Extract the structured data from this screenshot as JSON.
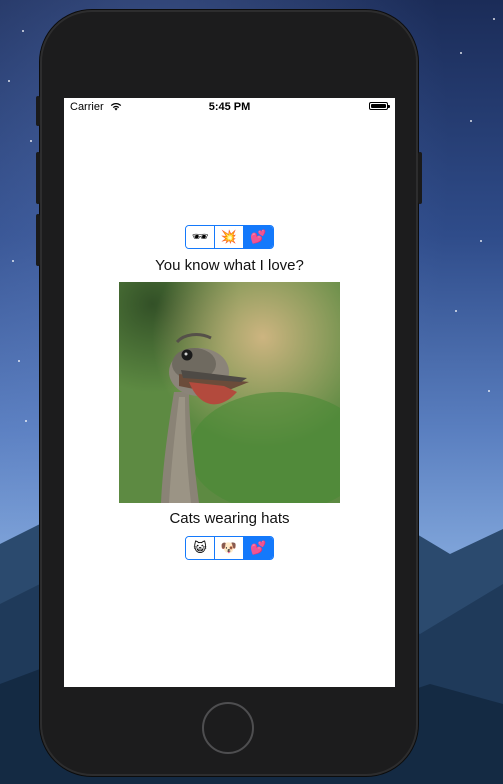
{
  "status_bar": {
    "carrier": "Carrier",
    "time": "5:45 PM"
  },
  "top_control": {
    "segments": [
      {
        "glyph": "🕶",
        "icon": "sunglasses-icon",
        "selected": false
      },
      {
        "glyph": "💥",
        "icon": "collision-icon",
        "selected": false
      },
      {
        "glyph": "💕",
        "icon": "two-hearts-icon",
        "selected": true
      }
    ]
  },
  "question": "You know what I love?",
  "photo": {
    "subject": "ostrich",
    "icon": "ostrich-photo"
  },
  "answer": "Cats wearing hats",
  "bottom_control": {
    "segments": [
      {
        "glyph": "😺",
        "icon": "cat-face-icon",
        "selected": false
      },
      {
        "glyph": "🐶",
        "icon": "dog-face-icon",
        "selected": false
      },
      {
        "glyph": "💕",
        "icon": "two-hearts-icon",
        "selected": true
      }
    ]
  },
  "colors": {
    "accent": "#1479fb",
    "device_body": "#1c1c1d",
    "screen_bg": "#ffffff"
  }
}
